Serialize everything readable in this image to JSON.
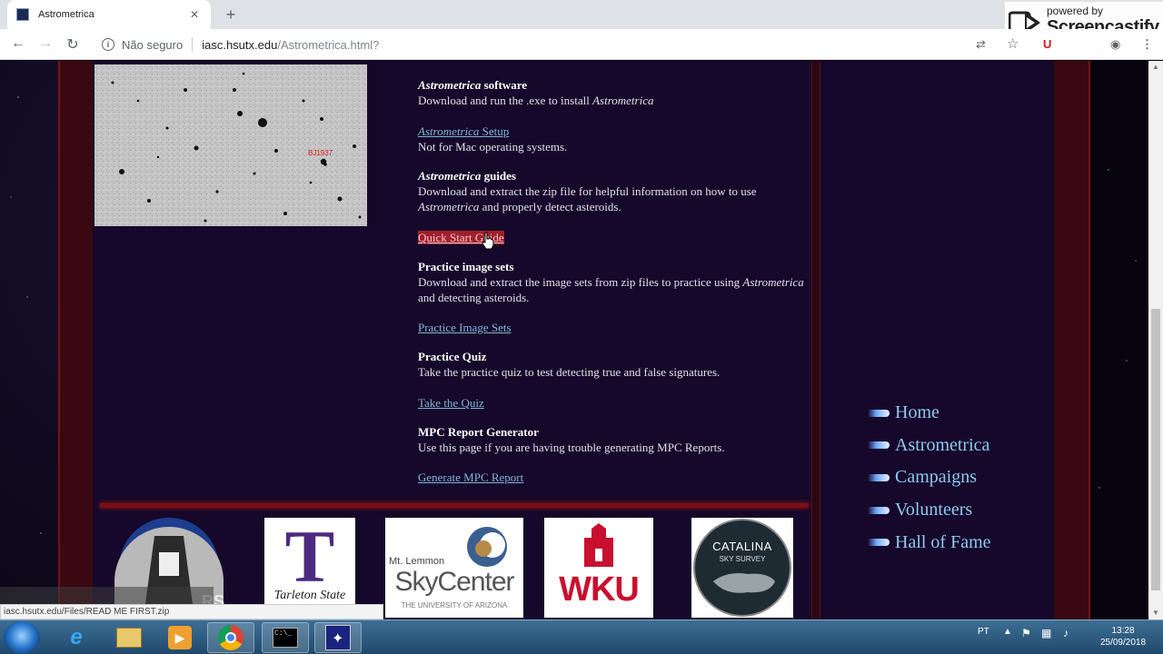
{
  "browser": {
    "tab_title": "Astrometrica",
    "new_tab": "+",
    "security_label": "Não seguro",
    "url_host": "iasc.hsutx.edu",
    "url_path": "/Astrometrica.html?",
    "minimize": "—",
    "watermark_powered": "powered by",
    "watermark_brand": "Screencastify"
  },
  "page": {
    "image_label": "BJ1937",
    "sections": [
      {
        "heading_em": "Astrometrica",
        "heading_rest": " software",
        "text": "Download and run the .exe to install ",
        "text_em": "Astrometrica"
      },
      {
        "link_em": "Astrometrica",
        "link_rest": " Setup",
        "text": "Not for Mac operating systems."
      },
      {
        "heading_em": "Astrometrica",
        "heading_rest": " guides",
        "text": "Download and extract the zip file for helpful information on how to use ",
        "text_em": "Astrometrica",
        "text_tail": " and properly detect asteroids."
      },
      {
        "link": "Quick Start Guide"
      },
      {
        "heading": "Practice image sets",
        "text": "Download and extract the image sets from zip files to practice using ",
        "text_em": "Astrometrica",
        "text_tail": " and detecting asteroids."
      },
      {
        "link": "Practice Image Sets"
      },
      {
        "heading": "Practice Quiz",
        "text": "Take the practice quiz to test detecting true and false signatures."
      },
      {
        "link": "Take the Quiz"
      },
      {
        "heading": "MPC Report Generator",
        "text": "Use this page if you are having trouble generating MPC Reports."
      },
      {
        "link": "Generate MPC Report"
      }
    ],
    "nav": [
      "Home",
      "Astrometrica",
      "Campaigns",
      "Volunteers",
      "Hall of Fame"
    ],
    "logos": {
      "iasc_text": "RS",
      "tarleton_letter": "T",
      "tarleton_text": "Tarleton State",
      "skycenter_small": "Mt. Lemmon",
      "skycenter_big": "SkyCenter",
      "skycenter_sub": "THE UNIVERSITY OF ARIZONA",
      "wku_text": "WKU",
      "catalina_title": "CATALINA",
      "catalina_sub": "SKY SURVEY"
    },
    "status_url": "iasc.hsutx.edu/Files/READ ME FIRST.zip"
  },
  "taskbar": {
    "language": "PT",
    "time": "13:28",
    "date": "25/09/2018"
  }
}
